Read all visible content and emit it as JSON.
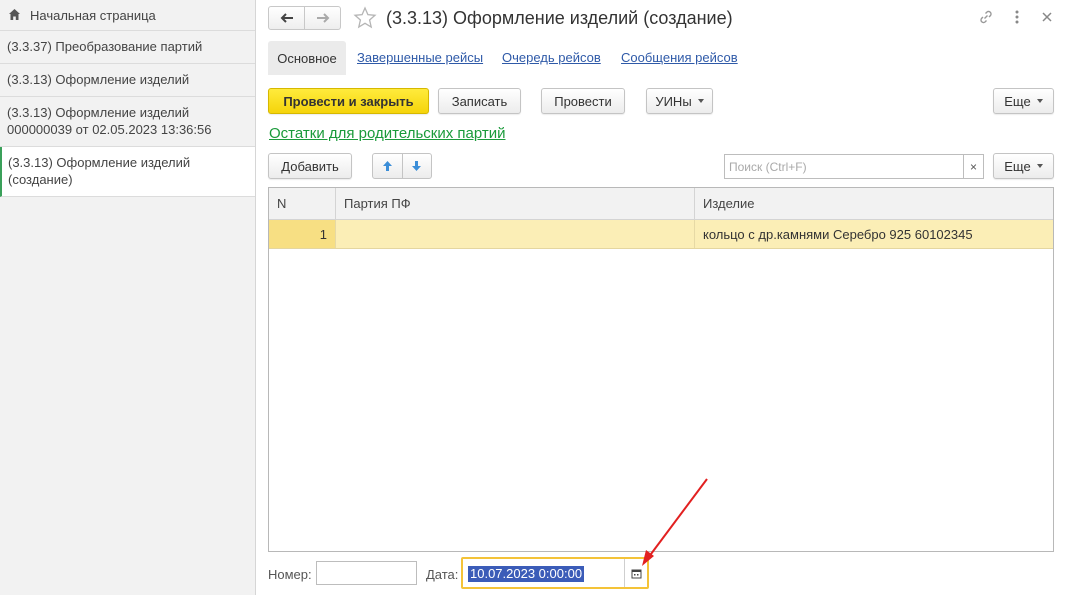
{
  "sidebar": {
    "items": [
      {
        "label": "Начальная страница"
      },
      {
        "label": "(3.3.37) Преобразование партий"
      },
      {
        "label": "(3.3.13) Оформление изделий"
      },
      {
        "label": "(3.3.13) Оформление изделий 000000039 от 02.05.2023 13:36:56"
      },
      {
        "label": "(3.3.13) Оформление изделий (создание)"
      }
    ]
  },
  "header": {
    "title": "(3.3.13) Оформление изделий (создание)"
  },
  "tabs": [
    "Основное",
    "Завершенные рейсы",
    "Очередь рейсов",
    "Сообщения рейсов"
  ],
  "toolbar": {
    "post_close": "Провести и закрыть",
    "save": "Записать",
    "post": "Провести",
    "uins": "УИНы",
    "more": "Еще"
  },
  "link_parent_balances": "Остатки для родительских партий",
  "table_toolbar": {
    "add": "Добавить",
    "search_placeholder": "Поиск (Ctrl+F)",
    "clear": "×",
    "more": "Еще"
  },
  "table": {
    "columns": [
      "N",
      "Партия ПФ",
      "Изделие"
    ],
    "rows": [
      {
        "n": "1",
        "batch": "",
        "item": "кольцо с др.камнями Серебро 925 60102345"
      }
    ]
  },
  "footer": {
    "number_label": "Номер:",
    "number_value": "",
    "date_label": "Дата:",
    "date_value": "10.07.2023  0:00:00"
  }
}
